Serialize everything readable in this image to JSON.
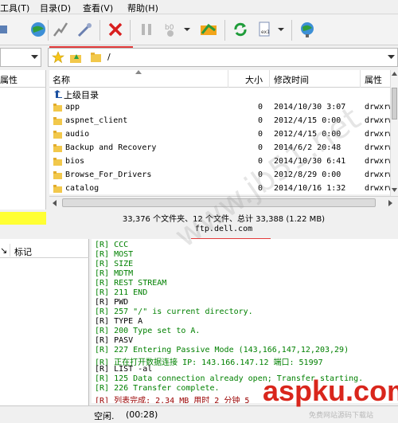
{
  "menu": {
    "tools": "工具(T)",
    "directory": "目录(D)",
    "view": "查看(V)",
    "help": "帮助(H)"
  },
  "path": {
    "left_value": "",
    "right_value": "/"
  },
  "left_header": {
    "attributes": "属性"
  },
  "columns": {
    "name": "名称",
    "size": "大小",
    "mtime": "修改时间",
    "attributes": "属性"
  },
  "parent_dir": "上级目录",
  "files": [
    {
      "name": "app",
      "size": "0",
      "mtime": "2014/10/30 3:07",
      "perm": "drwxrwxr"
    },
    {
      "name": "aspnet_client",
      "size": "0",
      "mtime": "2012/4/15 0:00",
      "perm": "drwxrwxr"
    },
    {
      "name": "audio",
      "size": "0",
      "mtime": "2012/4/15 0:00",
      "perm": "drwxrwxr"
    },
    {
      "name": "Backup and Recovery",
      "size": "0",
      "mtime": "2014/6/2 20:48",
      "perm": "drwxrwxr"
    },
    {
      "name": "bios",
      "size": "0",
      "mtime": "2014/10/30 6:41",
      "perm": "drwxrwxr"
    },
    {
      "name": "Browse_For_Drivers",
      "size": "0",
      "mtime": "2012/8/29 0:00",
      "perm": "drwxrwxr"
    },
    {
      "name": "catalog",
      "size": "0",
      "mtime": "2014/10/16 1:32",
      "perm": "drwxrwxr"
    }
  ],
  "status": {
    "summary": "33,376 个文件夹、12 个文件、总计 33,388 (1.22 MB)",
    "host": "ftp.dell.com"
  },
  "queue": {
    "col_arrow": "↘",
    "mark": "标记"
  },
  "log": [
    {
      "text": "[R]  CCC",
      "color": "green"
    },
    {
      "text": "[R]  MOST",
      "color": "green"
    },
    {
      "text": "[R]  SIZE",
      "color": "green"
    },
    {
      "text": "[R]  MDTM",
      "color": "green"
    },
    {
      "text": "[R]  REST STREAM",
      "color": "green"
    },
    {
      "text": "[R] 211 END",
      "color": "green"
    },
    {
      "text": "[R] PWD",
      "color": "black"
    },
    {
      "text": "[R] 257 \"/\" is current directory.",
      "color": "green"
    },
    {
      "text": "[R] TYPE A",
      "color": "black"
    },
    {
      "text": "[R] 200 Type set to A.",
      "color": "green"
    },
    {
      "text": "[R] PASV",
      "color": "black"
    },
    {
      "text": "[R] 227 Entering Passive Mode (143,166,147,12,203,29)",
      "color": "green"
    },
    {
      "text": "[R] 正在打开数据连接 IP: 143.166.147.12 端口: 51997",
      "color": "green"
    },
    {
      "text": "[R] LIST -al",
      "color": "black"
    },
    {
      "text": "[R] 125 Data connection already open; Transfer starting.",
      "color": "green"
    },
    {
      "text": "[R] 226 Transfer complete.",
      "color": "green"
    },
    {
      "text": "[R] 列表完成: 2.34 MB 用时 2 分钟 5",
      "color": "red"
    }
  ],
  "bottom": {
    "idle": "空闲.",
    "time": "(00:28)"
  },
  "brand": {
    "watermark": "www.jb51.net",
    "logo": "aspku.com",
    "logo_sub": "免费网站源码下载站"
  },
  "colors": {
    "log_green": "#008000",
    "log_red": "#9a0000",
    "highlight_yellow": "#ffff33",
    "redmark": "#e23a3a"
  }
}
